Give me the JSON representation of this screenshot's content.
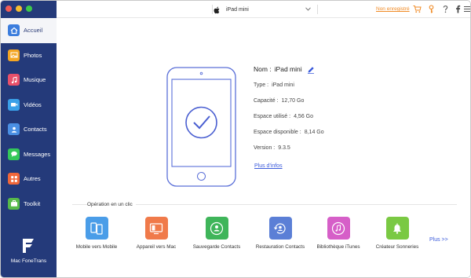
{
  "sidebar": {
    "items": [
      {
        "label": "Accueil",
        "icon": "home-icon",
        "color": "#3b7ddd",
        "active": true
      },
      {
        "label": "Photos",
        "icon": "photos-icon",
        "color": "#f4a623"
      },
      {
        "label": "Musique",
        "icon": "music-icon",
        "color": "#e8506a"
      },
      {
        "label": "Vidéos",
        "icon": "video-icon",
        "color": "#3aa0e8"
      },
      {
        "label": "Contacts",
        "icon": "contacts-icon",
        "color": "#4a8fe3"
      },
      {
        "label": "Messages",
        "icon": "messages-icon",
        "color": "#34c759"
      },
      {
        "label": "Autres",
        "icon": "others-icon",
        "color": "#f0673a"
      },
      {
        "label": "Toolkit",
        "icon": "toolkit-icon",
        "color": "#57b94a"
      }
    ],
    "brand": "Mac FoneTrans"
  },
  "topbar": {
    "device": "iPad mini",
    "register_link": "Non enregistré",
    "icons": [
      "cart-icon",
      "key-icon",
      "question-icon",
      "facebook-icon",
      "menu-icon"
    ],
    "accent": "#f08a24"
  },
  "device_info": {
    "nom_label": "Nom :",
    "nom_value": "iPad mini",
    "rows": [
      {
        "label": "Type :",
        "value": "iPad mini"
      },
      {
        "label": "Capacité :",
        "value": "12,70 Go"
      },
      {
        "label": "Espace utilisé :",
        "value": "4,56 Go"
      },
      {
        "label": "Espace disponible :",
        "value": "8,14 Go"
      },
      {
        "label": "Version :",
        "value": "9.3.5"
      }
    ],
    "more_link": "Plus d'infos"
  },
  "operations": {
    "title": "Opération en un clic",
    "items": [
      {
        "label": "Mobile vers Mobile",
        "icon": "phone-to-phone-icon",
        "color": "#4a9de8"
      },
      {
        "label": "Appareil vers Mac",
        "icon": "device-to-mac-icon",
        "color": "#f07a4a"
      },
      {
        "label": "Sauvegarde Contacts",
        "icon": "contacts-backup-icon",
        "color": "#3fb55a"
      },
      {
        "label": "Restauration Contacts",
        "icon": "contacts-restore-icon",
        "color": "#5b7fd6"
      },
      {
        "label": "Bibliothèque iTunes",
        "icon": "itunes-library-icon",
        "color": "#d65fc8"
      },
      {
        "label": "Créateur Sonneries",
        "icon": "ringtone-maker-icon",
        "color": "#7ac943"
      }
    ],
    "more": "Plus >>"
  }
}
